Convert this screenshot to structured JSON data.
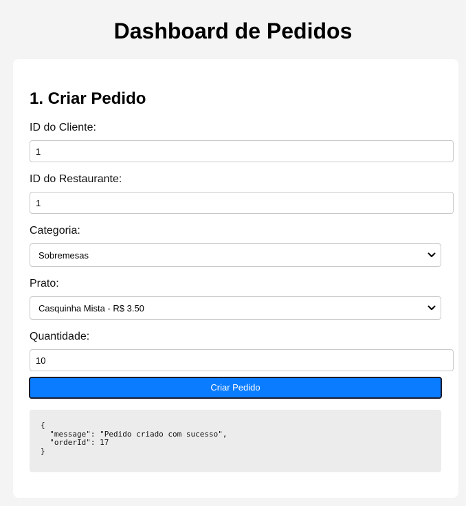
{
  "header": {
    "title": "Dashboard de Pedidos"
  },
  "form": {
    "section_title": "1. Criar Pedido",
    "client_id": {
      "label": "ID do Cliente:",
      "value": "1"
    },
    "restaurant_id": {
      "label": "ID do Restaurante:",
      "value": "1"
    },
    "category": {
      "label": "Categoria:",
      "selected": "Sobremesas"
    },
    "dish": {
      "label": "Prato:",
      "selected": "Casquinha Mista - R$ 3.50"
    },
    "quantity": {
      "label": "Quantidade:",
      "value": "10"
    },
    "submit_label": "Criar Pedido"
  },
  "response": {
    "text": "{\n  \"message\": \"Pedido criado com sucesso\",\n  \"orderId\": 17\n}"
  },
  "icons": {
    "select_chevron": "chevron-down-icon"
  },
  "colors": {
    "primary_button": "#0a7cff",
    "background": "#f4f4f4",
    "card": "#ffffff",
    "response_bg": "#ececec"
  }
}
